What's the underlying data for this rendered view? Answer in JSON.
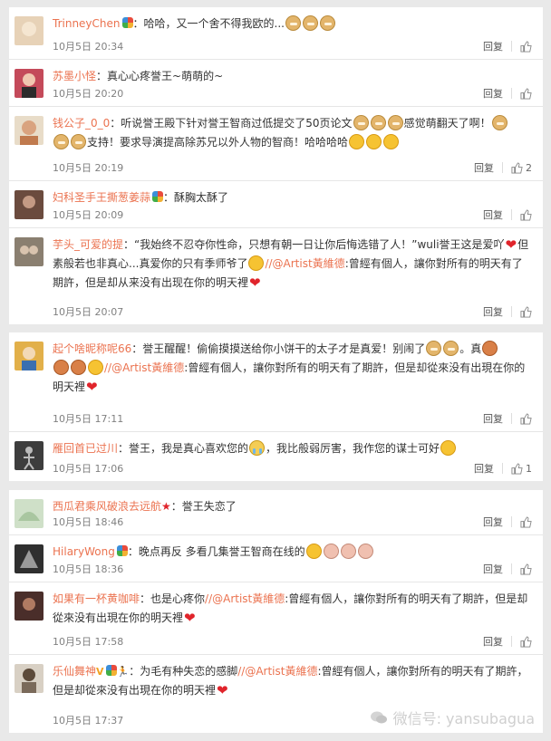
{
  "ui": {
    "reply_label": "回复",
    "thumb_icon": "thumb-up-icon"
  },
  "panels": [
    {
      "comments": [
        {
          "user": "TrinneyChen",
          "badge": true,
          "text": "：哈哈，又一个舍不得我欧的...",
          "time": "10月5日 20:34",
          "likes": "",
          "avatar": "#e7d2b7"
        },
        {
          "user": "苏墨小怪",
          "text": "：真心心疼誉王~萌萌的~",
          "time": "10月5日 20:20",
          "likes": "",
          "avatar": "#c44a5a"
        },
        {
          "user": "钱公子_0_0",
          "text": "：听说誉王殿下针对誉王智商过低提交了50页论文",
          "text2": "感觉萌翻天了啊！",
          "text3": "支持！要求导演提高除苏兄以外人物的智商！哈哈哈哈",
          "time": "10月5日 20:19",
          "likes": "2",
          "avatar": "#d9a37f"
        },
        {
          "user": "妇科圣手王撕葱姜蒜",
          "badge": true,
          "text": "：酥胸太酥了",
          "time": "10月5日 20:09",
          "likes": "",
          "avatar": "#6b4b3e"
        },
        {
          "user": "芋头_可爱的提",
          "text": "：“我始终不忍夺你性命，只想有朝一日让你后悔选错了人！”wuli誉王这是爱吖",
          "text2": "但素般若也非真心...真爱你的只有季师爷了",
          "text3_mention": "//@Artist黃維德",
          "text3": ":曾經有個人，讓你對所有的明天有了期許，但是却从来没有出现在你的明天裡",
          "time": "10月5日 20:07",
          "likes": "",
          "avatar": "#8a7f70"
        }
      ]
    },
    {
      "comments": [
        {
          "user": "起个啥昵称呢66",
          "text": "：誉王醒醒！偷偷摸摸送给你小饼干的太子才是真爱！别闹了",
          "text2": "。真",
          "mention": "//@Artist黃維德",
          "text3": ":曾經有個人，讓你對所有的明天有了期許，但是却從來没有出現在你的明天裡",
          "time": "10月5日 17:11",
          "likes": "",
          "avatar": "#e2b04a"
        },
        {
          "user": "雁回首已过川",
          "text": "：誉王，我是真心喜欢您的",
          "text2": "，我比般弱厉害，我作您的谋士可好",
          "time": "10月5日 17:06",
          "likes": "1",
          "avatar": "#3d3d3d"
        }
      ]
    },
    {
      "comments": [
        {
          "user": "西瓜君乘风破浪去远航",
          "star": true,
          "text": "：誉王失恋了",
          "time": "10月5日 18:46",
          "likes": "",
          "avatar": "#a9c6a0"
        },
        {
          "user": "HilaryWong",
          "badge": true,
          "text": "：晚点再反 多看几集誉王智商在线的",
          "time": "10月5日 18:36",
          "likes": "",
          "avatar": "#2f2f2f"
        },
        {
          "user": "如果有一杯黄咖啡",
          "text": "：也是心疼你",
          "mention": "//@Artist黃維德",
          "text3": ":曾經有個人，讓你對所有的明天有了期許，但是却從來没有出現在你的明天裡",
          "time": "10月5日 17:58",
          "likes": "",
          "avatar": "#4a2e2a"
        },
        {
          "user": "乐仙舞神",
          "vbadge": "V",
          "text": "：为毛有种失恋的感脚",
          "mention": "//@Artist黃維德",
          "text3": ":曾經有個人，讓你對所有的明天有了期許，但是却從來没有出現在你的明天裡",
          "time": "10月5日 17:37",
          "likes": "",
          "avatar": "#5c4a3a"
        }
      ]
    }
  ],
  "watermark": {
    "text": "微信号: yansubagua",
    "icon": "wechat-icon"
  }
}
